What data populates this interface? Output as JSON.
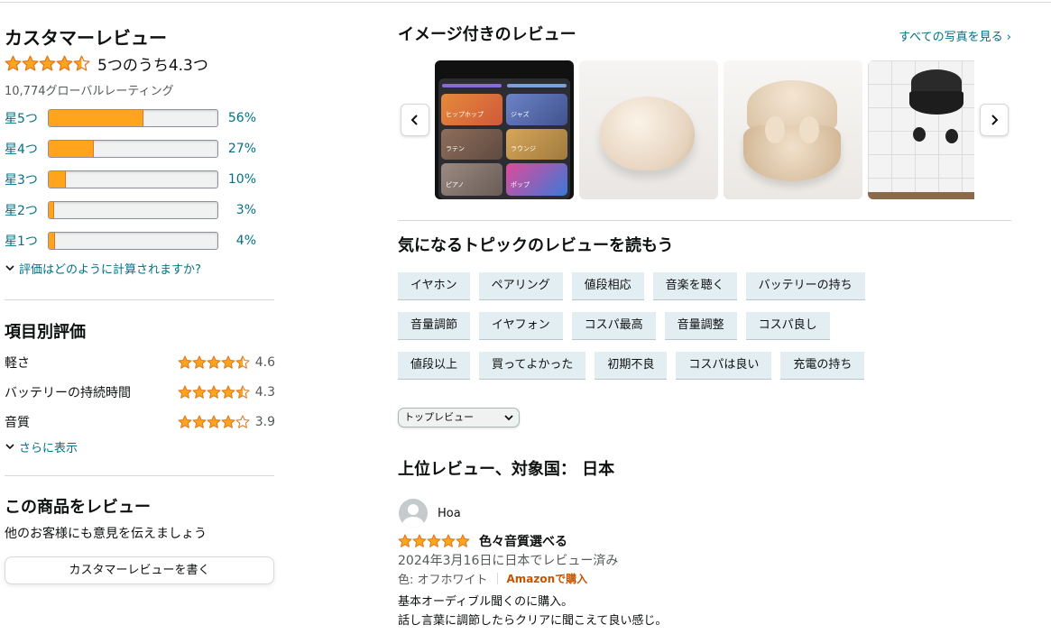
{
  "summary": {
    "title": "カスタマーレビュー",
    "average_text": "5つのうち4.3つ",
    "average_rating": 4.3,
    "global_ratings": "10,774グローバルレーティング",
    "histogram": [
      {
        "label": "星5つ",
        "pct": "56%",
        "fill": 56
      },
      {
        "label": "星4つ",
        "pct": "27%",
        "fill": 27
      },
      {
        "label": "星3つ",
        "pct": "10%",
        "fill": 10
      },
      {
        "label": "星2つ",
        "pct": "3%",
        "fill": 3
      },
      {
        "label": "星1つ",
        "pct": "4%",
        "fill": 4
      }
    ],
    "how_calculated": "評価はどのように計算されますか?"
  },
  "attributes": {
    "title": "項目別評価",
    "items": [
      {
        "name": "軽さ",
        "value": "4.6",
        "rating": 4.6
      },
      {
        "name": "バッテリーの持続時間",
        "value": "4.3",
        "rating": 4.3
      },
      {
        "name": "音質",
        "value": "3.9",
        "rating": 3.9
      }
    ],
    "show_more": "さらに表示"
  },
  "write_review": {
    "title": "この商品をレビュー",
    "subtitle": "他のお客様にも意見を伝えましょう",
    "button": "カスタマーレビューを書く"
  },
  "images": {
    "title": "イメージ付きのレビュー",
    "see_all": "すべての写真を見る ›",
    "tiles": [
      "ヒップホップ",
      "ジャズ",
      "ラテン",
      "ラウンジ",
      "ピアノ",
      "ポップ"
    ]
  },
  "topics": {
    "title": "気になるトピックのレビューを読もう",
    "rows": [
      [
        "イヤホン",
        "ペアリング",
        "値段相応",
        "音楽を聴く",
        "バッテリーの持ち"
      ],
      [
        "音量調節",
        "イヤフォン",
        "コスパ最高",
        "音量調整",
        "コスパ良し"
      ],
      [
        "値段以上",
        "買ってよかった",
        "初期不良",
        "コスパは良い",
        "充電の持ち"
      ]
    ]
  },
  "sort": {
    "selected": "トップレビュー"
  },
  "top_reviews": {
    "title": "上位レビュー、対象国： 日本"
  },
  "review": {
    "user": "Hoa",
    "rating": 5,
    "title": "色々音質選べる",
    "date": "2024年3月16日に日本でレビュー済み",
    "color": "色: オフホワイト",
    "verified": "Amazonで購入",
    "body": [
      "基本オーディブル聞くのに購入。",
      "話し言葉に調節したらクリアに聞こえて良い感じ。"
    ]
  },
  "colors": {
    "star": "#FFA41C",
    "star_outline": "#DE7921",
    "link": "#007185",
    "verified": "#C45500",
    "chip_bg": "#E3EEF2"
  },
  "icons": [
    "star-icon",
    "half-star-icon",
    "chevron-down-icon",
    "chevron-left-icon",
    "chevron-right-icon",
    "avatar-icon"
  ]
}
